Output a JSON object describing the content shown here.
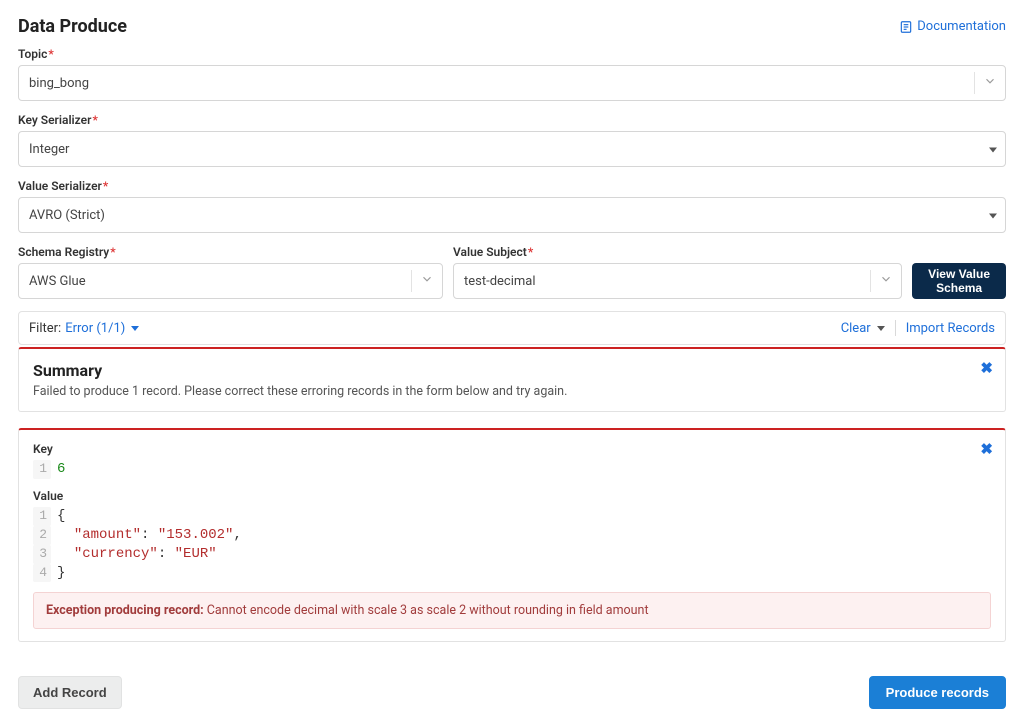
{
  "header": {
    "title": "Data Produce",
    "documentation": "Documentation"
  },
  "fields": {
    "topic": {
      "label": "Topic",
      "value": "bing_bong"
    },
    "key_serializer": {
      "label": "Key Serializer",
      "value": "Integer"
    },
    "value_serializer": {
      "label": "Value Serializer",
      "value": "AVRO (Strict)"
    },
    "schema_registry": {
      "label": "Schema Registry",
      "value": "AWS Glue"
    },
    "value_subject": {
      "label": "Value Subject",
      "value": "test-decimal"
    },
    "view_value_schema": "View Value\nSchema"
  },
  "filter_bar": {
    "label": "Filter:",
    "filter_text": "Error (1/1)",
    "clear": "Clear",
    "import": "Import Records"
  },
  "summary": {
    "heading": "Summary",
    "text": "Failed to produce 1 record. Please correct these erroring records in the form below and try again."
  },
  "record": {
    "key_label": "Key",
    "key_lines": [
      {
        "n": "1",
        "type": "number",
        "content": "6"
      }
    ],
    "value_label": "Value",
    "value_lines": [
      {
        "n": "1",
        "tokens": [
          {
            "t": "brace",
            "v": "{"
          }
        ]
      },
      {
        "n": "2",
        "tokens": [
          {
            "t": "indent",
            "v": "  "
          },
          {
            "t": "key",
            "v": "\"amount\""
          },
          {
            "t": "colon",
            "v": ": "
          },
          {
            "t": "str",
            "v": "\"153.002\""
          },
          {
            "t": "comma",
            "v": ","
          }
        ]
      },
      {
        "n": "3",
        "tokens": [
          {
            "t": "indent",
            "v": "  "
          },
          {
            "t": "key",
            "v": "\"currency\""
          },
          {
            "t": "colon",
            "v": ": "
          },
          {
            "t": "str",
            "v": "\"EUR\""
          }
        ]
      },
      {
        "n": "4",
        "tokens": [
          {
            "t": "brace",
            "v": "}"
          }
        ]
      }
    ],
    "error_label": "Exception producing record:",
    "error_text": "Cannot encode decimal with scale 3 as scale 2 without rounding in field amount"
  },
  "footer": {
    "add_record": "Add Record",
    "produce_records": "Produce records"
  }
}
